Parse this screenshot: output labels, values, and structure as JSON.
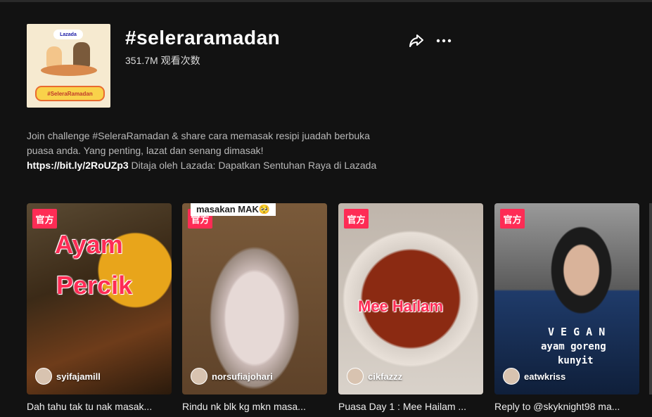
{
  "hashtag": {
    "title": "#seleraramadan",
    "views": "351.7M 观看次数",
    "avatar_brand": "Lazada",
    "avatar_tag": "#SeleraRamadan"
  },
  "icons": {
    "share": "share-icon",
    "more": "more-icon"
  },
  "description": {
    "text": "Join challenge #SeleraRamadan & share cara memasak resipi juadah berbuka puasa anda. Yang penting, lazat dan senang dimasak!",
    "link": "https://bit.ly/2RoUZp3",
    "sponsor": " Ditaja oleh Lazada: Dapatkan Sentuhan Raya di Lazada"
  },
  "videos": [
    {
      "badge": "官方",
      "overlay": [
        "Ayam",
        "Percik"
      ],
      "author": "syifajamill",
      "caption": "Dah tahu tak tu nak masak...",
      "colors": [
        "#3b2a17",
        "#7a4a22",
        "#e2a21a"
      ]
    },
    {
      "badge": "官方",
      "overlay": [
        "masakan MAK🥺"
      ],
      "author": "norsufiajohari",
      "caption": "Rindu nk blk kg mkn masa...",
      "colors": [
        "#6b4a2c",
        "#a98a6a",
        "#e8dcd8"
      ]
    },
    {
      "badge": "官方",
      "overlay": [
        "Mee Hailam"
      ],
      "author": "cikfazzz",
      "caption": "Puasa Day 1 : Mee Hailam ...",
      "colors": [
        "#4a1d0c",
        "#a0381a",
        "#d8a040"
      ]
    },
    {
      "badge": "官方",
      "overlay": [
        "V E G A N",
        "ayam goreng",
        "kunyit"
      ],
      "author": "eatwkriss",
      "caption": "Reply to @skyknight98 ma...",
      "colors": [
        "#2a2a2a",
        "#8a8a8a",
        "#1f3b6a"
      ]
    }
  ]
}
